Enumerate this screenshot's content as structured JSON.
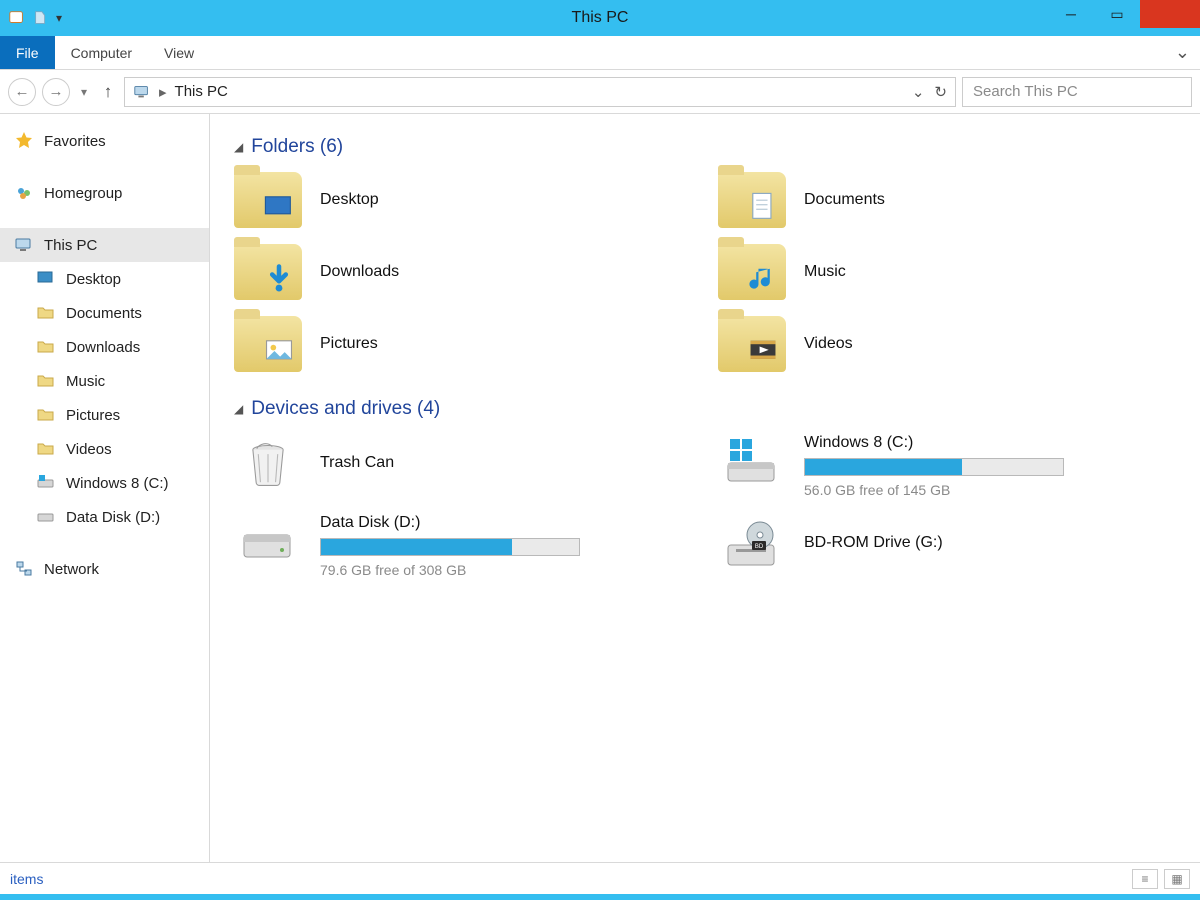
{
  "window": {
    "title": "This PC"
  },
  "ribbon": {
    "tabs": [
      "File",
      "Computer",
      "View"
    ]
  },
  "nav": {
    "breadcrumb": "This PC",
    "search_placeholder": "Search This PC"
  },
  "sidebar": {
    "favorites_label": "Favorites",
    "homegroup_label": "Homegroup",
    "this_pc_label": "This PC",
    "this_pc_children": [
      "Desktop",
      "Documents",
      "Downloads",
      "Music",
      "Pictures",
      "Videos",
      "Windows 8 (C:)",
      "Data Disk (D:)"
    ],
    "network_label": "Network"
  },
  "sections": {
    "folders_header": "Folders (6)",
    "drives_header": "Devices and drives (4)"
  },
  "folders": [
    {
      "label": "Desktop"
    },
    {
      "label": "Documents"
    },
    {
      "label": "Downloads"
    },
    {
      "label": "Music"
    },
    {
      "label": "Pictures"
    },
    {
      "label": "Videos"
    }
  ],
  "drives": {
    "trash": {
      "label": "Trash Can"
    },
    "c": {
      "label": "Windows 8 (C:)",
      "free_text": "56.0 GB free of 145 GB",
      "fill_percent": 61
    },
    "d": {
      "label": "Data Disk (D:)",
      "free_text": "79.6 GB free of 308 GB",
      "fill_percent": 74
    },
    "g": {
      "label": "BD-ROM Drive (G:)"
    }
  },
  "statusbar": {
    "text": "items"
  }
}
